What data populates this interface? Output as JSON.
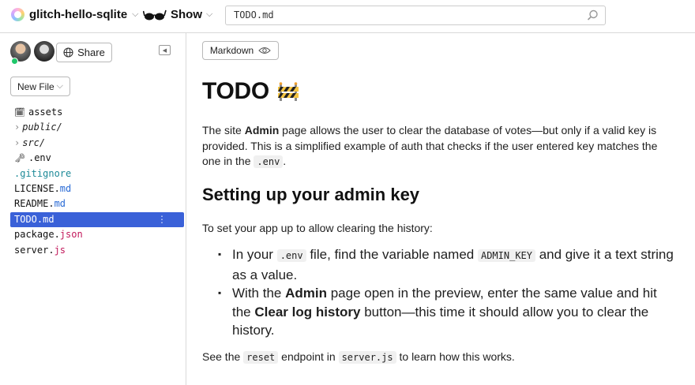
{
  "topbar": {
    "project_name": "glitch-hello-sqlite",
    "show_label": "Show",
    "search_value": "TODO.md"
  },
  "sidebar": {
    "share_label": "Share",
    "new_file_label": "New File",
    "files": [
      {
        "name": "assets",
        "ext": "",
        "kind": "assets"
      },
      {
        "name": "public/",
        "ext": "",
        "kind": "folder"
      },
      {
        "name": "src/",
        "ext": "",
        "kind": "folder"
      },
      {
        "name": ".env",
        "ext": "",
        "kind": "env"
      },
      {
        "name": ".gitignore",
        "ext": "",
        "kind": "dot"
      },
      {
        "name": "LICENSE.",
        "ext": "md",
        "kind": "file"
      },
      {
        "name": "README.",
        "ext": "md",
        "kind": "file"
      },
      {
        "name": "TODO.",
        "ext": "md",
        "kind": "active"
      },
      {
        "name": "package.",
        "ext": "json",
        "kind": "file"
      },
      {
        "name": "server.",
        "ext": "js",
        "kind": "file"
      }
    ]
  },
  "main": {
    "markdown_button": "Markdown",
    "h1": "TODO",
    "p1_a": "The site ",
    "p1_b": "Admin",
    "p1_c": " page allows the user to clear the database of votes—but only if a valid key is provided. This is a simplified example of auth that checks if the user entered key matches the one in the ",
    "p1_code": ".env",
    "p1_d": ".",
    "h2": "Setting up your admin key",
    "p2": "To set your app up to allow clearing the history:",
    "li1_a": "In your ",
    "li1_code1": ".env",
    "li1_b": " file, find the variable named ",
    "li1_code2": "ADMIN_KEY",
    "li1_c": " and give it a text string as a value.",
    "li2_a": "With the ",
    "li2_b": "Admin",
    "li2_c": " page open in the preview, enter the same value and hit the ",
    "li2_d": "Clear log history",
    "li2_e": " button—this time it should allow you to clear the history.",
    "p3_a": "See the ",
    "p3_code1": "reset",
    "p3_b": " endpoint in ",
    "p3_code2": "server.js",
    "p3_c": " to learn how this works."
  },
  "colors": {
    "accent": "#3a61d8",
    "online": "#1fc76a",
    "ext_md": "#2a6bd6",
    "ext_js": "#c2185b"
  },
  "icons": [
    "glitch-logo-icon",
    "glasses-icon",
    "search-icon",
    "globe-icon",
    "collapse-sidebar-icon",
    "eye-icon",
    "construction-icon"
  ]
}
